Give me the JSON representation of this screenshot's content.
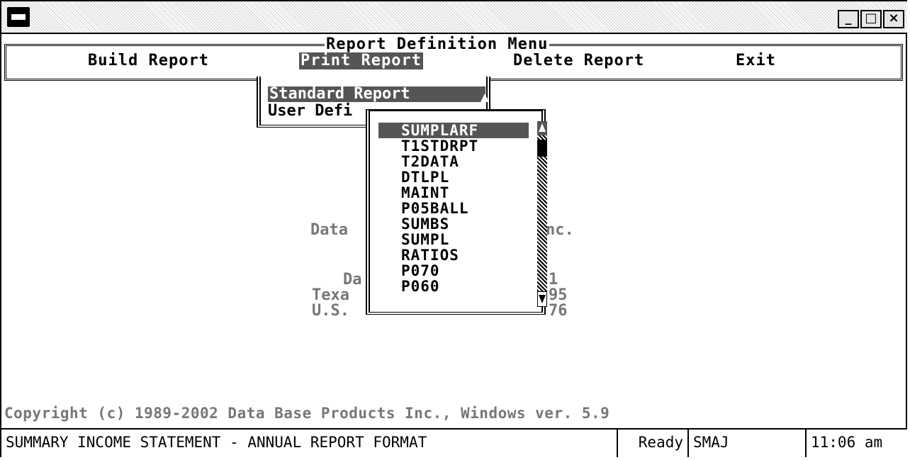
{
  "window": {
    "buttons": {
      "minimize": "_",
      "maximize": "□",
      "close": "×"
    }
  },
  "menu": {
    "title": "Report Definition Menu",
    "items": [
      {
        "label": "Build Report"
      },
      {
        "label": "Print Report",
        "selected": true
      },
      {
        "label": "Delete Report"
      },
      {
        "label": "Exit"
      }
    ]
  },
  "print_submenu": {
    "items": [
      {
        "label": "Standard Report",
        "selected": true
      },
      {
        "label": "User Defi"
      }
    ]
  },
  "background_text": {
    "line1_left": "Data",
    "line1_right": "nc.",
    "line2_left": "Da",
    "line2_right": "1",
    "line3_left": "Texa",
    "line3_right": "95",
    "line4_left": "U.S.",
    "line4_right": "76"
  },
  "report_list": {
    "items": [
      {
        "label": "SUMPLARF",
        "selected": true
      },
      {
        "label": "T1STDRPT"
      },
      {
        "label": "T2DATA"
      },
      {
        "label": "DTLPL"
      },
      {
        "label": "MAINT"
      },
      {
        "label": "P05BALL"
      },
      {
        "label": "SUMBS"
      },
      {
        "label": "SUMPL"
      },
      {
        "label": "RATIOS"
      },
      {
        "label": "P070"
      },
      {
        "label": "P060"
      }
    ]
  },
  "copyright": "Copyright (c) 1989-2002 Data Base Products Inc., Windows ver. 5.9",
  "status_bar": {
    "description": "SUMMARY INCOME STATEMENT - ANNUAL REPORT FORMAT",
    "state": "Ready",
    "user": "SMAJ",
    "time": "11:06 am"
  }
}
